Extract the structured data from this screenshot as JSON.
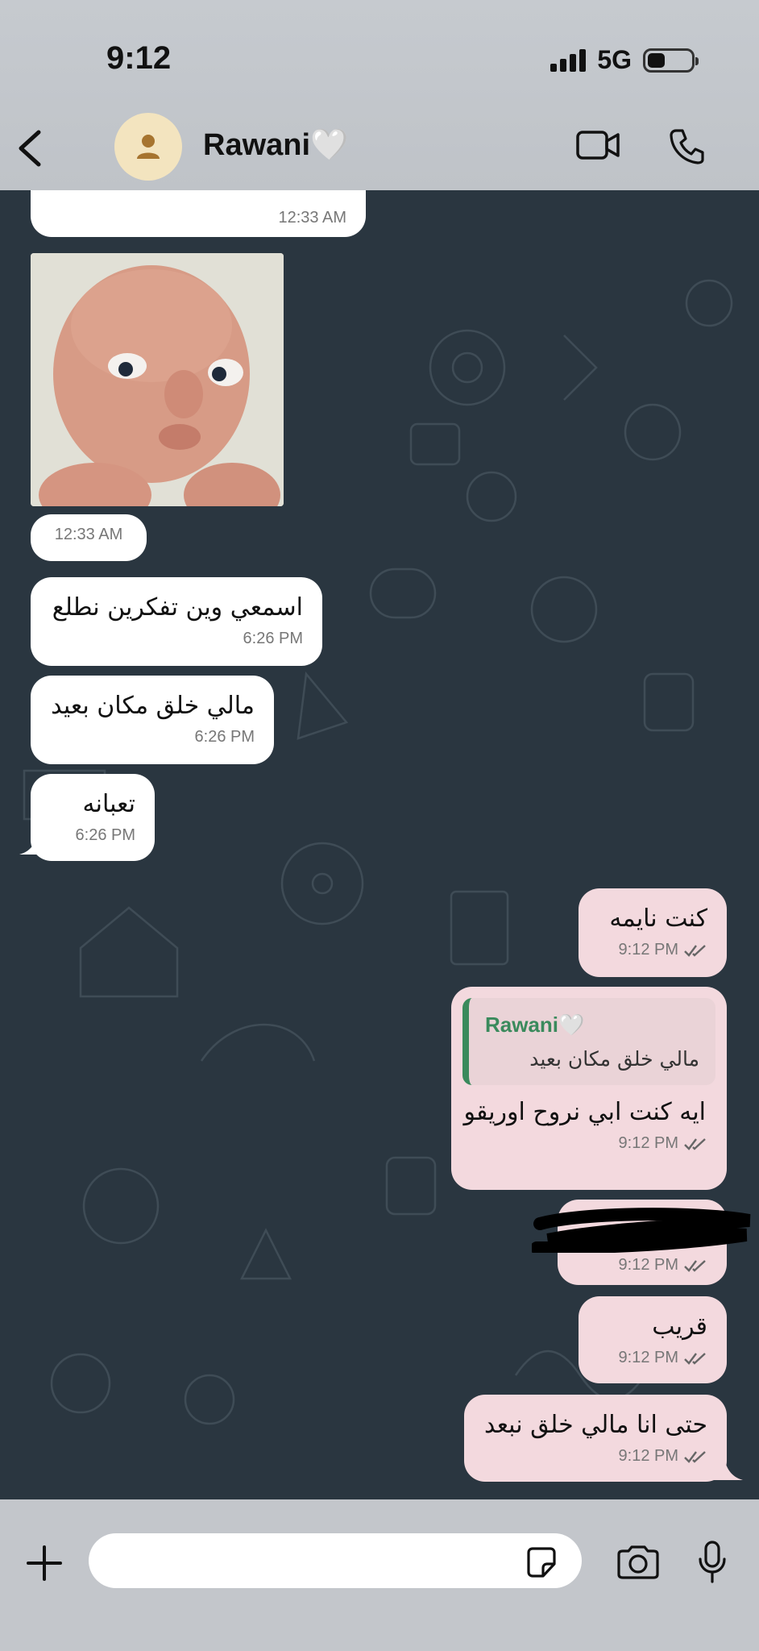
{
  "status_bar": {
    "time": "9:12",
    "network": "5G",
    "battery_level": 0.4
  },
  "header": {
    "contact_name": "Rawani🤍",
    "back_icon": "chevron-left-icon",
    "avatar_icon": "person-icon",
    "video_icon": "video-camera-icon",
    "call_icon": "phone-icon"
  },
  "messages": [
    {
      "direction": "in",
      "text": "",
      "time": "12:33 AM"
    },
    {
      "direction": "in",
      "type": "image",
      "time": "12:33 AM"
    },
    {
      "direction": "in",
      "text": "اسمعي وين تفكرين نطلع",
      "time": "6:26 PM"
    },
    {
      "direction": "in",
      "text": "مالي خلق مكان بعيد",
      "time": "6:26 PM"
    },
    {
      "direction": "in",
      "text": "تعبانه",
      "time": "6:26 PM"
    },
    {
      "direction": "out",
      "text": "كنت نايمه",
      "time": "9:12 PM"
    },
    {
      "direction": "out",
      "text": "ايه كنت ابي نروح اوريقو",
      "time": "9:12 PM",
      "reply": {
        "author": "Rawani🤍",
        "text": "مالي خلق مكان بعيد"
      }
    },
    {
      "direction": "out",
      "text": "",
      "time": "9:12 PM",
      "redacted": true
    },
    {
      "direction": "out",
      "text": "قريب",
      "time": "9:12 PM"
    },
    {
      "direction": "out",
      "text": "حتى انا مالي خلق نبعد",
      "time": "9:12 PM"
    }
  ],
  "composer": {
    "placeholder": "",
    "plus_icon": "plus-icon",
    "sticker_icon": "sticker-icon",
    "camera_icon": "camera-icon",
    "mic_icon": "microphone-icon"
  },
  "colors": {
    "chat_bg": "#2a3640",
    "incoming_bubble": "#ffffff",
    "outgoing_bubble": "#f3d9de",
    "reply_accent": "#3a8a5c"
  }
}
